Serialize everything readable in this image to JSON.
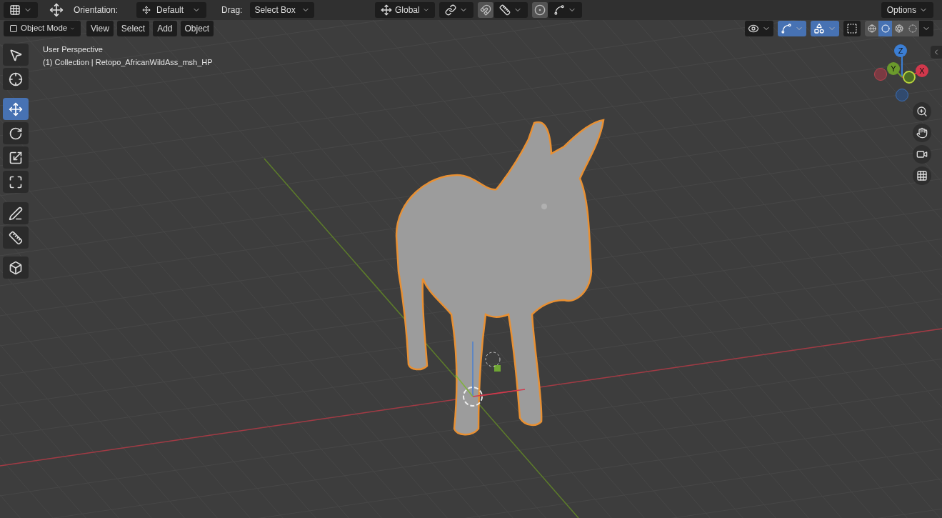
{
  "header": {
    "orientation_label": "Orientation:",
    "orientation": "Default",
    "drag_label": "Drag:",
    "drag": "Select Box",
    "transform_orientation": "Global",
    "options": "Options"
  },
  "view_header": {
    "mode": "Object Mode",
    "menus": [
      "View",
      "Select",
      "Add",
      "Object"
    ]
  },
  "viewport_toggles": [
    {
      "kind": "visibility",
      "on": false
    },
    {
      "kind": "gizmo",
      "on": true
    },
    {
      "kind": "overlays",
      "on": true
    },
    {
      "kind": "xray",
      "on": false
    }
  ],
  "shading": [
    {
      "kind": "wireframe",
      "selected": false
    },
    {
      "kind": "solid",
      "selected": true
    },
    {
      "kind": "material",
      "selected": false
    },
    {
      "kind": "rendered",
      "selected": false
    }
  ],
  "viewport_info": {
    "view": "User Perspective",
    "object": "(1) Collection | Retopo_AfricanWildAss_msh_HP"
  },
  "tools": [
    {
      "kind": "select_box",
      "selected": false
    },
    {
      "kind": "cursor",
      "selected": false
    },
    {
      "kind": "move",
      "selected": true
    },
    {
      "kind": "rotate",
      "selected": false
    },
    {
      "kind": "scale",
      "selected": false
    },
    {
      "kind": "transform",
      "selected": false
    },
    {
      "kind": "annotate",
      "selected": false
    },
    {
      "kind": "measure",
      "selected": false
    },
    {
      "kind": "add_cube",
      "selected": false
    }
  ],
  "navigation_gizmo": {
    "axes": [
      {
        "kind": "z",
        "label": "Z"
      },
      {
        "kind": "y",
        "label": "Y"
      },
      {
        "kind": "x",
        "label": "X"
      }
    ]
  }
}
